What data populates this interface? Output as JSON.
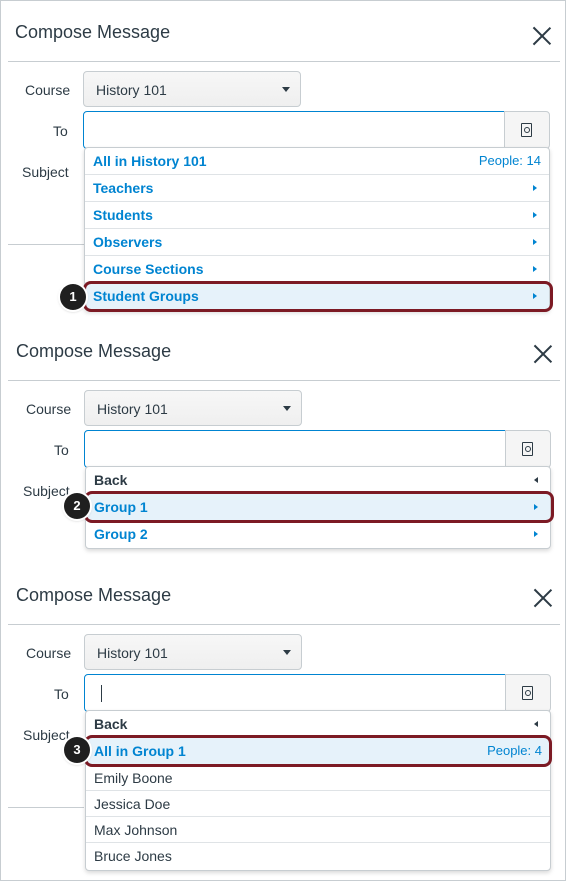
{
  "panels": [
    {
      "title": "Compose Message",
      "course_label": "Course",
      "course_value": "History 101",
      "to_label": "To",
      "subject_label": "Subject",
      "step": "1",
      "menu": [
        {
          "label": "All in History 101",
          "meta": "People: 14"
        },
        {
          "label": "Teachers"
        },
        {
          "label": "Students"
        },
        {
          "label": "Observers"
        },
        {
          "label": "Course Sections"
        },
        {
          "label": "Student Groups"
        }
      ]
    },
    {
      "title": "Compose Message",
      "course_label": "Course",
      "course_value": "History 101",
      "to_label": "To",
      "subject_label": "Subject",
      "step": "2",
      "menu": [
        {
          "label": "Back"
        },
        {
          "label": "Group 1"
        },
        {
          "label": "Group 2"
        }
      ]
    },
    {
      "title": "Compose Message",
      "course_label": "Course",
      "course_value": "History 101",
      "to_label": "To",
      "subject_label": "Subject",
      "step": "3",
      "menu": [
        {
          "label": "Back"
        },
        {
          "label": "All in Group 1",
          "meta": "People: 4"
        },
        {
          "label": "Emily Boone"
        },
        {
          "label": "Jessica Doe"
        },
        {
          "label": "Max Johnson"
        },
        {
          "label": "Bruce Jones"
        }
      ]
    }
  ],
  "colors": {
    "accent": "#0084d1",
    "highlight_outline": "#7c1a24",
    "text": "#2d3b45"
  },
  "icons": [
    "close-icon",
    "address-book-icon",
    "caret-down-icon",
    "chevron-right-icon",
    "chevron-left-icon"
  ]
}
